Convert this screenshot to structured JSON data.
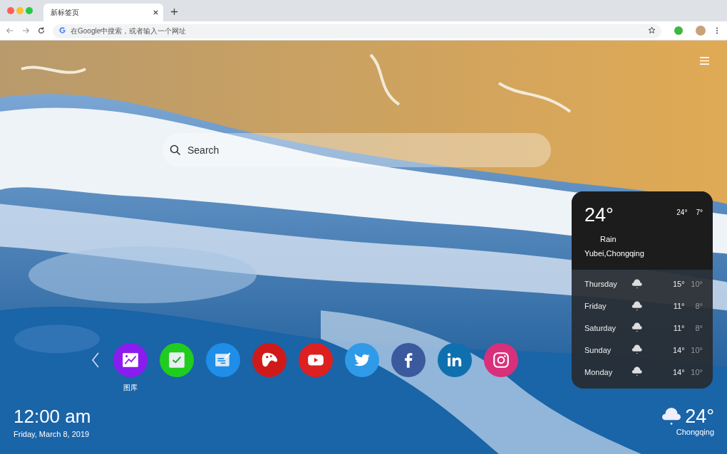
{
  "browser": {
    "tab": {
      "title": "新标签页",
      "selected": true
    },
    "address": {
      "placeholder": "在Google中搜索，或者输入一个网址"
    }
  },
  "search": {
    "placeholder": "Search"
  },
  "weather_card": {
    "temperature": "24°",
    "high": "24°",
    "low": "7°",
    "condition": "Rain",
    "location": "Yubei,Chongqing",
    "forecast": [
      {
        "day": "Thursday",
        "high": "15°",
        "low": "10°"
      },
      {
        "day": "Friday",
        "high": "11°",
        "low": "8°"
      },
      {
        "day": "Saturday",
        "high": "11°",
        "low": "8°"
      },
      {
        "day": "Sunday",
        "high": "14°",
        "low": "10°"
      },
      {
        "day": "Monday",
        "high": "14°",
        "low": "10°"
      }
    ]
  },
  "shortcuts": [
    {
      "kind": "gallery",
      "color": "#8a1cf0",
      "label": "图库"
    },
    {
      "kind": "check",
      "color": "#1fcc1f"
    },
    {
      "kind": "notes",
      "color": "#1e8ee8"
    },
    {
      "kind": "game",
      "color": "#d01a1a"
    },
    {
      "kind": "youtube",
      "color": "#dd2020"
    },
    {
      "kind": "twitter",
      "color": "#2f9be8"
    },
    {
      "kind": "facebook",
      "color": "#3b5a9e"
    },
    {
      "kind": "linkedin",
      "color": "#0f70b0"
    },
    {
      "kind": "instagram",
      "color": "#d8307a"
    }
  ],
  "clock": {
    "time": "12:00 am",
    "date": "Friday, March 8, 2019"
  },
  "weather_corner": {
    "temperature": "24°",
    "city": "Chongqing"
  }
}
